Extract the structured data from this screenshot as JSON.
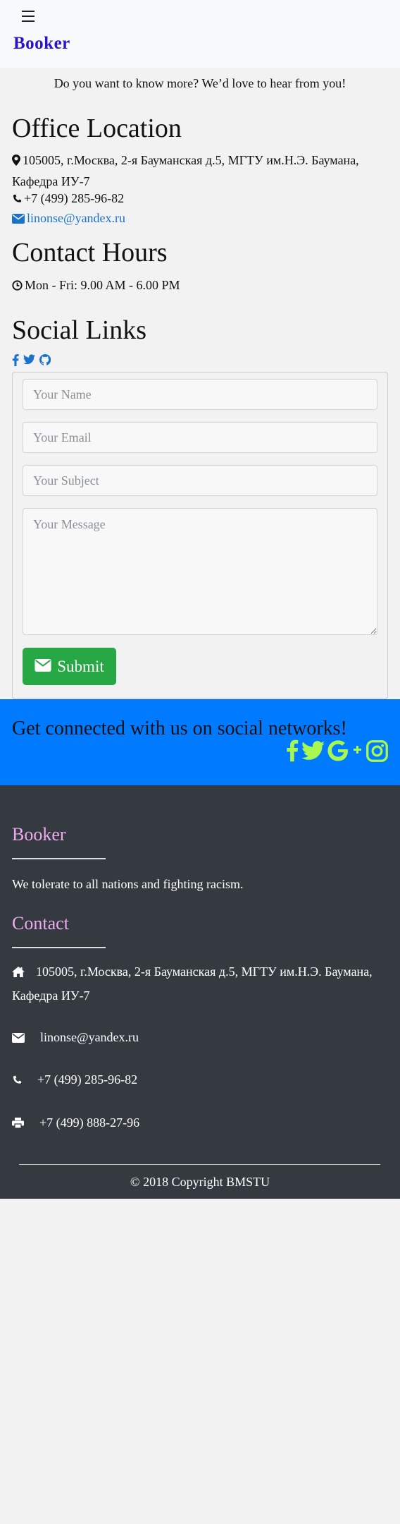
{
  "navbar": {
    "brand": "Booker",
    "menu_icon": "hamburger-icon"
  },
  "intro": "Do you want to know more? We’d love to hear from you!",
  "office": {
    "title": "Office Location",
    "address": "105005, г.Москва, 2-я Бауманская д.5, МГТУ им.Н.Э. Баумана, Кафедра ИУ-7",
    "phone": "+7 (499) 285-96-82",
    "email": "linonse@yandex.ru"
  },
  "hours": {
    "title": "Contact Hours",
    "text": "Mon - Fri: 9.00 AM - 6.00 PM"
  },
  "social": {
    "title": "Social Links",
    "icons": [
      "facebook-icon",
      "twitter-icon",
      "github-icon"
    ]
  },
  "form": {
    "name_placeholder": "Your Name",
    "email_placeholder": "Your Email",
    "subject_placeholder": "Your Subject",
    "message_placeholder": "Your Message",
    "submit_label": "Submit"
  },
  "band": {
    "title": "Get connected with us on social networks!",
    "icons": [
      "facebook-icon",
      "twitter-icon",
      "google-plus-icon",
      "instagram-icon"
    ]
  },
  "footer": {
    "brand_title": "Booker",
    "brand_text": "We tolerate to all nations and fighting racism.",
    "contact_title": "Contact",
    "address": "105005, г.Москва, 2-я Бауманская д.5, МГТУ им.Н.Э. Баумана, Кафедра ИУ-7",
    "email": "linonse@yandex.ru",
    "phone": "+7 (499) 285-96-82",
    "fax": "+7 (499) 888-27-96",
    "copyright": "© 2018 Copyright BMSTU"
  },
  "colors": {
    "brand": "#2a14c9",
    "accent_blue": "#007bff",
    "submit_green": "#28a745",
    "band_icons": "#a9f84f",
    "footer_bg": "#343a40",
    "footer_title": "#eeaaf0",
    "link": "#1a73c9"
  }
}
